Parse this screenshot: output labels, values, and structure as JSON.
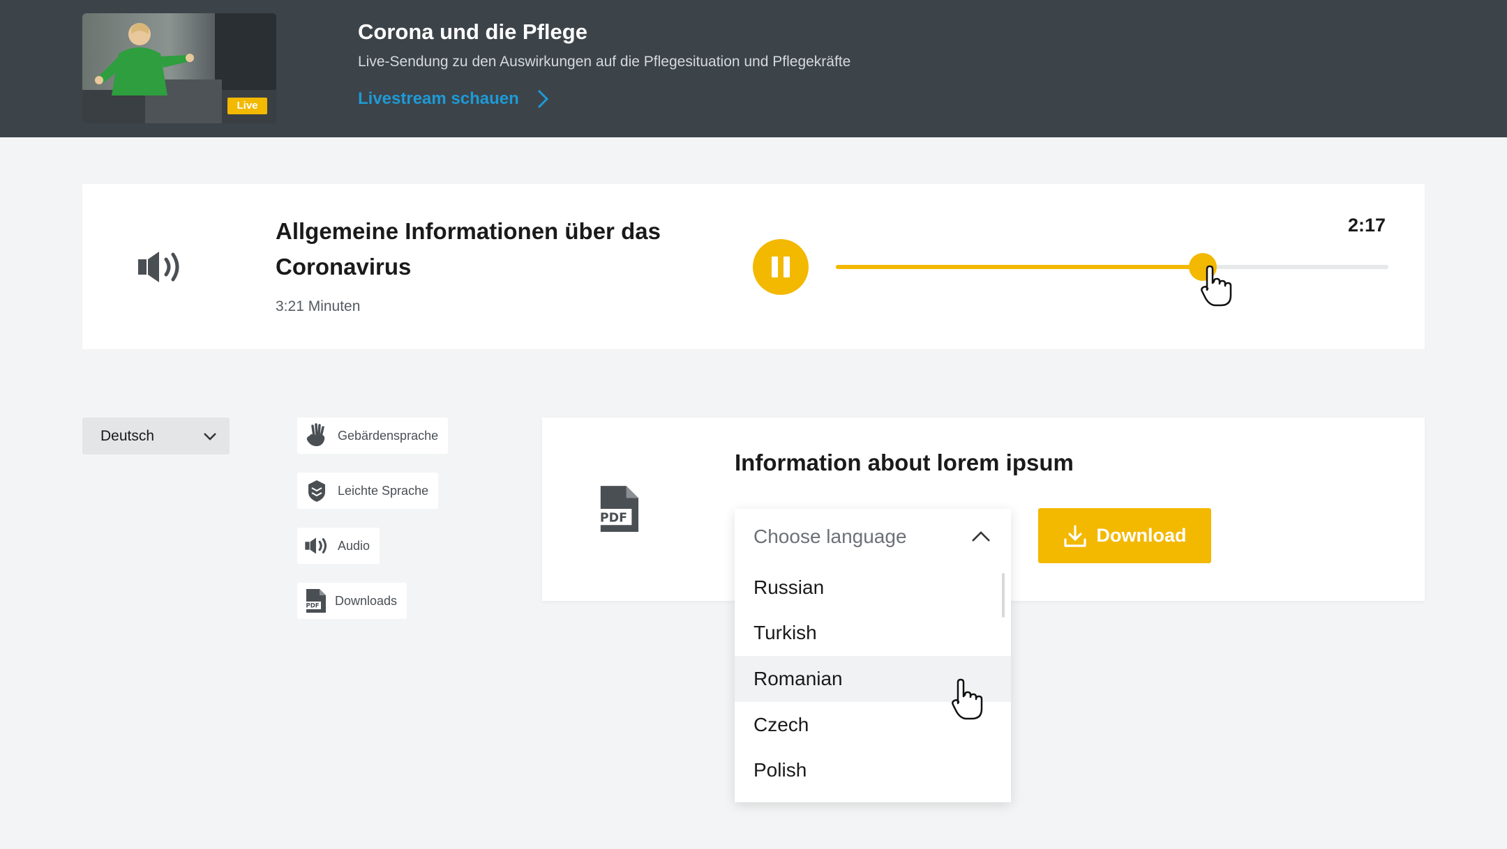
{
  "banner": {
    "title": "Corona und die Pflege",
    "subtitle": "Live-Sendung zu den Auswirkungen auf die Pflegesituation und Pflegekräfte",
    "link_label": "Livestream schauen",
    "live_badge": "Live",
    "background_color": "#3c4349",
    "link_color": "#1e9ad6"
  },
  "audio": {
    "title": "Allgemeine Informationen über das Coronavirus",
    "duration": "3:21 Minuten",
    "current_time": "2:17",
    "progress": 0.664,
    "state": "playing",
    "icon": "speaker-icon",
    "accent_color": "#f3b800"
  },
  "language_select": {
    "value": "Deutsch"
  },
  "side_nav": [
    {
      "label": "Gebärdensprache",
      "icon": "sign-language-hand-icon"
    },
    {
      "label": "Leichte Sprache",
      "icon": "easy-language-icon"
    },
    {
      "label": "Audio",
      "icon": "speaker-icon"
    },
    {
      "label": "Downloads",
      "icon": "pdf-icon"
    }
  ],
  "info_card": {
    "title": "Information about lorem ipsum",
    "icon": "pdf-icon",
    "download_label": "Download"
  },
  "language_dropdown": {
    "placeholder": "Choose language",
    "expanded": true,
    "hovered": "Romanian",
    "options": [
      "Russian",
      "Turkish",
      "Romanian",
      "Czech",
      "Polish"
    ]
  }
}
